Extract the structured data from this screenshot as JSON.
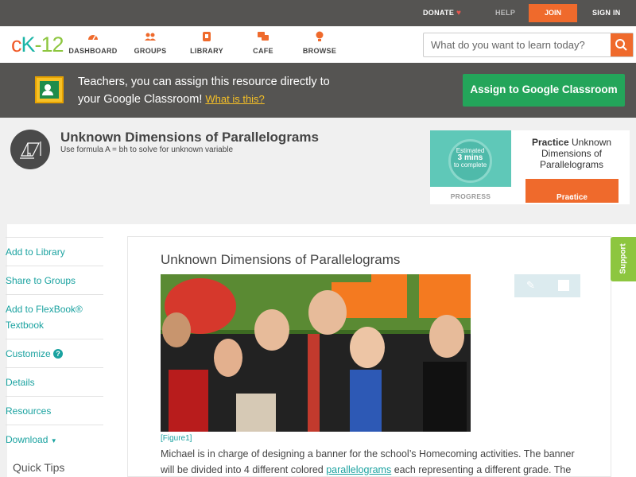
{
  "topbar": {
    "donate": "DONATE",
    "help": "HELP",
    "join": "JOIN",
    "signin": "SIGN IN"
  },
  "nav": {
    "logo": {
      "c": "c",
      "k": "K",
      "n": "-12"
    },
    "items": [
      {
        "label": "DASHBOARD",
        "icon": "dashboard-icon"
      },
      {
        "label": "GROUPS",
        "icon": "groups-icon"
      },
      {
        "label": "LIBRARY",
        "icon": "library-icon"
      },
      {
        "label": "CAFE",
        "icon": "cafe-icon"
      },
      {
        "label": "BROWSE",
        "icon": "browse-icon"
      }
    ],
    "search_placeholder": "What do you want to learn today?"
  },
  "classroom": {
    "line1": "Teachers, you can assign this resource directly to",
    "line2": "your Google Classroom!",
    "what": "What is this?",
    "assign": "Assign to Google Classroom"
  },
  "header": {
    "title": "Unknown Dimensions of Parallelograms",
    "subtitle": "Use formula A = bh to solve for unknown variable"
  },
  "practice": {
    "estimated": "Estimated",
    "mins": "3 mins",
    "to_complete": "to complete",
    "progress": "PROGRESS",
    "label_bold": "Practice",
    "label_rest": "Unknown Dimensions of Parallelograms",
    "button": "Practice"
  },
  "sidebar": {
    "items": [
      "Add to Library",
      "Share to Groups",
      "Add to FlexBook®",
      "Textbook",
      "Customize",
      "Details",
      "Resources",
      "Download"
    ],
    "quick_tips": "Quick Tips"
  },
  "content": {
    "title": "Unknown Dimensions of Parallelograms",
    "figure_caption": "[Figure1]",
    "para_before": "Michael is in charge of designing a banner for the school’s Homecoming activities. The banner will be divided into 4 different colored ",
    "para_link": "parallelograms",
    "para_after": " each representing a different grade. The"
  },
  "support": "Support",
  "colors": {
    "accent_orange": "#ef6a2c",
    "teal": "#1aa2a0",
    "green": "#23a55a",
    "dark_bar": "#555452"
  }
}
